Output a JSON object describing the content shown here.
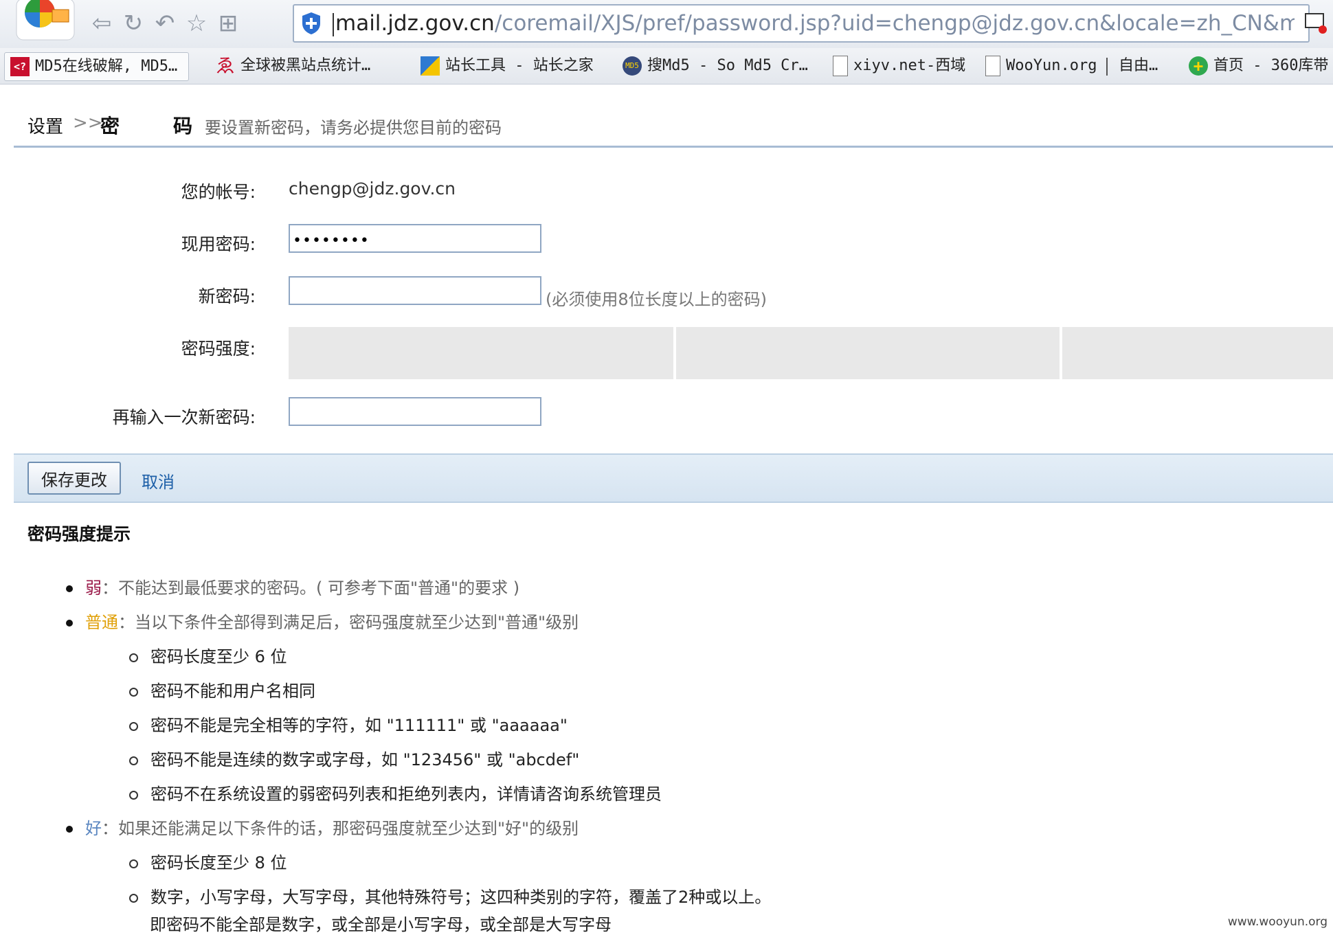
{
  "browser": {
    "url_host": "mail.jdz.gov.cn",
    "url_path": "/coremail/XJS/pref/password.jsp?uid=chengp@jdz.gov.cn&locale=zh_CN&mustChange=true",
    "bookmarks": [
      {
        "label": "MD5在线破解, MD5…"
      },
      {
        "label": "全球被黑站点统计…"
      },
      {
        "label": "站长工具 - 站长之家"
      },
      {
        "label": "搜Md5 - So Md5 Cr…"
      },
      {
        "label": "xiyv.net-西域"
      },
      {
        "label": "WooYun.org"
      },
      {
        "label": "自由…"
      },
      {
        "label": "首页 - 360库带"
      }
    ]
  },
  "header": {
    "crumb_settings": "设置",
    "crumb_separator": ">>",
    "crumb_current": "密码",
    "hint": "要设置新密码，请务必提供您目前的密码"
  },
  "form": {
    "account_label": "您的帐号:",
    "account_value": "chengp@jdz.gov.cn",
    "current_password_label": "现用密码:",
    "current_password_mask": "••••••••",
    "new_password_label": "新密码:",
    "new_password_hint": "(必须使用8位长度以上的密码)",
    "strength_label": "密码强度:",
    "confirm_label": "再输入一次新密码:"
  },
  "actions": {
    "save_label": "保存更改",
    "cancel_label": "取消"
  },
  "tips": {
    "title": "密码强度提示",
    "weak": {
      "level": "弱",
      "text": "：不能达到最低要求的密码。( 可参考下面\"普通\"的要求 )"
    },
    "normal": {
      "level": "普通",
      "text": "：当以下条件全部得到满足后，密码强度就至少达到\"普通\"级别",
      "items": [
        "密码长度至少 6 位",
        "密码不能和用户名相同",
        "密码不能是完全相等的字符，如 \"111111\" 或 \"aaaaaa\"",
        "密码不能是连续的数字或字母，如 \"123456\" 或 \"abcdef\"",
        "密码不在系统设置的弱密码列表和拒绝列表内，详情请咨询系统管理员"
      ]
    },
    "good": {
      "level": "好",
      "text": "：如果还能满足以下条件的话，那密码强度就至少达到\"好\"的级别",
      "items": [
        "密码长度至少 8 位",
        "数字，小写字母，大写字母，其他特殊符号；这四种类别的字符，覆盖了2种或以上。"
      ],
      "continuation": "即密码不能全部是数字，或全部是小写字母，或全部是大写字母"
    }
  },
  "watermark": "www.wooyun.org",
  "colors": {
    "weak": "#9b1b4a",
    "normal": "#e0a008",
    "good": "#5a86c0",
    "link": "#1d5fa8",
    "header_rule": "#a8bcd4"
  }
}
